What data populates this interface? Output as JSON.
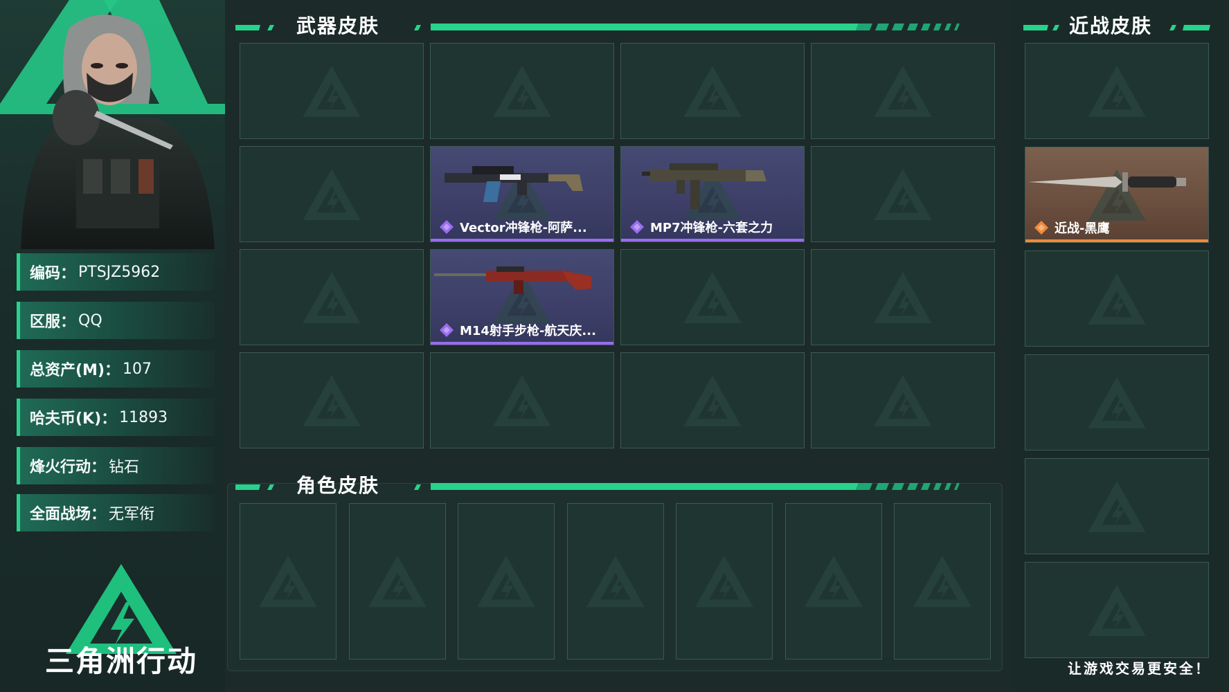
{
  "profile": {
    "fields": [
      {
        "label": "编码：",
        "value": "PTSJZ5962"
      },
      {
        "label": "区服：",
        "value": "QQ"
      },
      {
        "label": "总资产(M)：",
        "value": "107"
      },
      {
        "label": "哈夫币(K)：",
        "value": "11893"
      },
      {
        "label": "烽火行动：",
        "value": "钻石"
      },
      {
        "label": "全面战场：",
        "value": "无军衔"
      }
    ]
  },
  "brand": {
    "name": "三角洲行动",
    "slogan": "让游戏交易更安全！"
  },
  "sections": {
    "weapon": {
      "title": "武器皮肤",
      "items": [
        {
          "row": 1,
          "col": 1,
          "name": "Vector冲锋枪-阿萨...",
          "rarity_color": "#9a6cf0",
          "icon": "smg-vector-icon"
        },
        {
          "row": 1,
          "col": 2,
          "name": "MP7冲锋枪-六套之力",
          "rarity_color": "#9a6cf0",
          "icon": "smg-mp7-icon"
        },
        {
          "row": 2,
          "col": 1,
          "name": "M14射手步枪-航天庆...",
          "rarity_color": "#9a6cf0",
          "icon": "rifle-m14-icon"
        }
      ]
    },
    "melee": {
      "title": "近战皮肤",
      "items": [
        {
          "row": 1,
          "name": "近战-黑鹰",
          "rarity_color": "#f08a3c",
          "icon": "knife-icon"
        }
      ]
    },
    "role": {
      "title": "角色皮肤",
      "items": []
    }
  },
  "colors": {
    "accent": "#27d38c",
    "purple": "#9a6cf0",
    "orange": "#f08a3c"
  }
}
